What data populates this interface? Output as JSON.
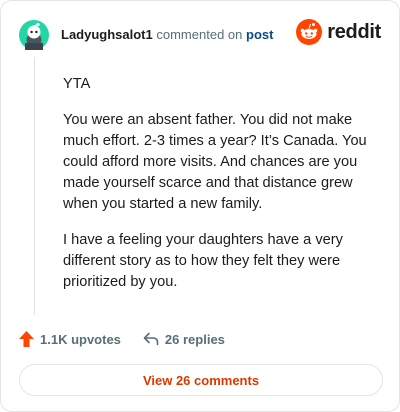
{
  "header": {
    "username": "Ladyughsalot1",
    "commented_on": "commented on",
    "post_link": "post",
    "brand_name": "reddit",
    "avatar_icon": "snoo-avatar-icon",
    "brand_icon": "reddit-logo-icon"
  },
  "comment": {
    "paragraphs": [
      "YTA",
      "You were an absent father. You did not make much effort. 2-3 times a year? It’s Canada. You could afford more visits. And chances are you made yourself scarce and that distance grew when you started a new family.",
      "I have a feeling your daughters have a very different story as to how they felt they were prioritized by you."
    ]
  },
  "actions": {
    "upvotes": "1.1K upvotes",
    "replies": "26 replies",
    "upvote_icon": "upvote-arrow-icon",
    "reply_icon": "reply-arrow-icon"
  },
  "view_button": {
    "label": "View 26 comments"
  },
  "colors": {
    "brand_orange": "#ff4500",
    "avatar_teal": "#24d6a5",
    "link_blue": "#0a4a8a",
    "button_text": "#d93a00",
    "muted": "#576f76"
  }
}
